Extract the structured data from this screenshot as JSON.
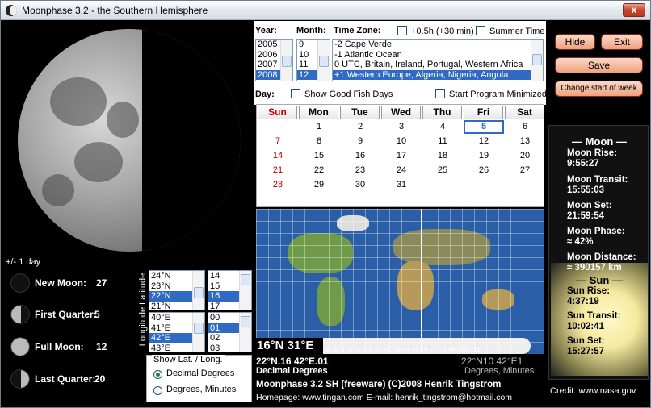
{
  "window": {
    "title": "Moonphase 3.2 - the Southern Hemisphere",
    "close": "x"
  },
  "left": {
    "range_label": "+/- 1 day",
    "phases": [
      {
        "name": "New Moon:",
        "value": "27"
      },
      {
        "name": "First Quarter:",
        "value": "5"
      },
      {
        "name": "Full Moon:",
        "value": "12"
      },
      {
        "name": "Last Quarter:",
        "value": "20"
      }
    ],
    "latlon_label": "Longitude Latitude",
    "lat_deg": [
      "24°N",
      "23°N",
      "22°N",
      "21°N"
    ],
    "lat_min": [
      "14",
      "15",
      "16",
      "17"
    ],
    "lon_deg": [
      "40°E",
      "41°E",
      "42°E",
      "43°E"
    ],
    "lon_min": [
      "00",
      "01",
      "02",
      "03"
    ],
    "show_group": {
      "title": "Show Lat. / Long.",
      "opt1": "Decimal Degrees",
      "opt2": "Degrees, Minutes"
    }
  },
  "top": {
    "year_label": "Year:",
    "month_label": "Month:",
    "tz_label": "Time Zone:",
    "half_hour": "+0.5h (+30 min)",
    "summer": "Summer Time",
    "years": [
      "2005",
      "2006",
      "2007",
      "2008"
    ],
    "months": [
      "9",
      "10",
      "11",
      "12"
    ],
    "zones": [
      "-2  Cape Verde",
      "-1  Atlantic Ocean",
      "0   UTC, Britain, Ireland, Portugal, Western Africa",
      "+1  Western Europe, Algeria, Nigeria, Angola"
    ],
    "day_label": "Day:",
    "fish": "Show Good Fish Days",
    "minimized": "Start Program Minimized"
  },
  "calendar": {
    "headers": [
      "Sun",
      "Mon",
      "Tue",
      "Wed",
      "Thu",
      "Fri",
      "Sat"
    ],
    "rows": [
      [
        "",
        "1",
        "2",
        "3",
        "4",
        "5",
        "6"
      ],
      [
        "7",
        "8",
        "9",
        "10",
        "11",
        "12",
        "13"
      ],
      [
        "14",
        "15",
        "16",
        "17",
        "18",
        "19",
        "20"
      ],
      [
        "21",
        "22",
        "23",
        "24",
        "25",
        "26",
        "27"
      ],
      [
        "28",
        "29",
        "30",
        "31",
        "",
        "",
        ""
      ]
    ]
  },
  "map": {
    "coords": "16°N  31°E",
    "tz_scale": "-6 -5 -4 -3 -2 -1  0 +1 +2 +3 +4 +5 +6 +7 +8 +9 +10 +11",
    "decimal_value": "22°N.16  42°E.01",
    "decimal_label": "Decimal Degrees",
    "dm_value": "22°N10  42°E1",
    "dm_label": "Degrees, Minutes"
  },
  "footer": {
    "line1": "Moonphase 3.2 SH (freeware) (C)2008 Henrik Tingstrom",
    "line2": "Homepage: www.tingan.com   E-mail: henrik_tingstrom@hotmail.com",
    "credit": "Credit: www.nasa.gov"
  },
  "buttons": {
    "hide": "Hide",
    "exit": "Exit",
    "save": "Save",
    "change_week": "Change start of week"
  },
  "moon": {
    "header": "— Moon —",
    "rise_label": "Moon Rise:",
    "rise": "9:55:27",
    "transit_label": "Moon Transit:",
    "transit": "15:55:03",
    "set_label": "Moon Set:",
    "set": "21:59:54",
    "phase_label": "Moon Phase:",
    "phase": "≈ 42%",
    "distance_label": "Moon Distance:",
    "distance": "≈ 390157 km"
  },
  "sun": {
    "header": "— Sun —",
    "rise_label": "Sun Rise:",
    "rise": "4:37:19",
    "transit_label": "Sun Transit:",
    "transit": "10:02:41",
    "set_label": "Sun Set:",
    "set": "15:27:57"
  }
}
